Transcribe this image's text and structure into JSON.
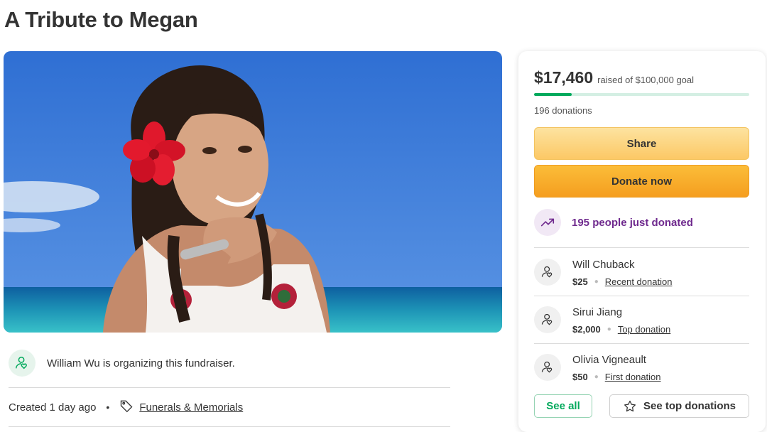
{
  "page": {
    "title": "A Tribute to Megan"
  },
  "hero_image": {
    "alt": "Photo of Megan smiling by the sea with a red flower in her hair"
  },
  "organizer": {
    "icon": "person-heart-icon",
    "text": "William Wu is organizing this fundraiser."
  },
  "meta": {
    "created": "Created 1 day ago",
    "separator": "•",
    "category_icon": "tag-icon",
    "category": "Funerals & Memorials"
  },
  "donation_card": {
    "amount_raised": "$17,460",
    "goal_text": "raised of $100,000 goal",
    "progress_fraction": 0.1746,
    "donations_count": "196 donations",
    "share_label": "Share",
    "donate_label": "Donate now",
    "trend_icon": "trending-up-icon",
    "trend_text": "195 people just donated",
    "donors": [
      {
        "name": "Will Chuback",
        "amount": "$25",
        "type": "Recent donation"
      },
      {
        "name": "Sirui Jiang",
        "amount": "$2,000",
        "type": "Top donation"
      },
      {
        "name": "Olivia Vigneault",
        "amount": "$50",
        "type": "First donation"
      }
    ],
    "see_all_label": "See all",
    "see_top_label": "See top donations"
  },
  "colors": {
    "brand_green": "#02a95c",
    "progress_track": "#d4efe3",
    "donate_orange": "#f59e1f",
    "share_yellow": "#fcc865",
    "trend_purple": "#6f2a8e"
  }
}
